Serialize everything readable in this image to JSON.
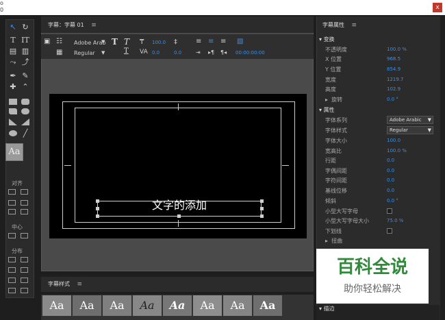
{
  "window": {
    "close_label": "x",
    "corner_marks": "o\n0"
  },
  "tools": {
    "section_align": "对齐",
    "section_center": "中心",
    "section_distribute": "分布",
    "style_swatch": "Aa"
  },
  "center": {
    "tab_title": "字幕：字幕 01",
    "menu_glyph": "≡",
    "font_family": "Adobe Arab",
    "font_style": "Regular",
    "font_size_value": "100.0",
    "kerning_value": "0.0",
    "leading_value": "0.0",
    "timecode": "00:00:00:00",
    "caption_text": "文字的添加"
  },
  "styles": {
    "title": "字幕样式",
    "swatches": [
      "Aa",
      "Aa",
      "Aa",
      "Aa",
      "Aa",
      "Aa",
      "Aa",
      "Aa"
    ]
  },
  "props": {
    "title": "字幕属性",
    "sections": {
      "transform": "变换",
      "rotation": "旋转",
      "properties": "属性",
      "distort": "扭曲",
      "border": "描边"
    },
    "rows": [
      {
        "label": "不透明度",
        "value": "100.0 %"
      },
      {
        "label": "X 位置",
        "value": "968.5"
      },
      {
        "label": "Y 位置",
        "value": "854.9"
      },
      {
        "label": "宽度",
        "value": "1219.7"
      },
      {
        "label": "高度",
        "value": "102.9"
      }
    ],
    "rotation_value": "0.0 °",
    "font_family_label": "字体系列",
    "font_family_value": "Adobe Arabic",
    "font_style_label": "字体样式",
    "font_style_value": "Regular",
    "prop_rows": [
      {
        "label": "字体大小",
        "value": "100.0"
      },
      {
        "label": "宽高比",
        "value": "100.0 %"
      },
      {
        "label": "行距",
        "value": "0.0"
      },
      {
        "label": "字偶间距",
        "value": "0.0"
      },
      {
        "label": "字符间距",
        "value": "0.0"
      },
      {
        "label": "基线位移",
        "value": "0.0"
      },
      {
        "label": "倾斜",
        "value": "0.0 °"
      }
    ],
    "small_caps_label": "小型大写字母",
    "small_caps_size_label": "小型大写字母大小",
    "small_caps_size_value": "75.0 %",
    "underline_label": "下划线"
  },
  "watermark": {
    "title": "百科全说",
    "subtitle": "助你轻松解决"
  }
}
